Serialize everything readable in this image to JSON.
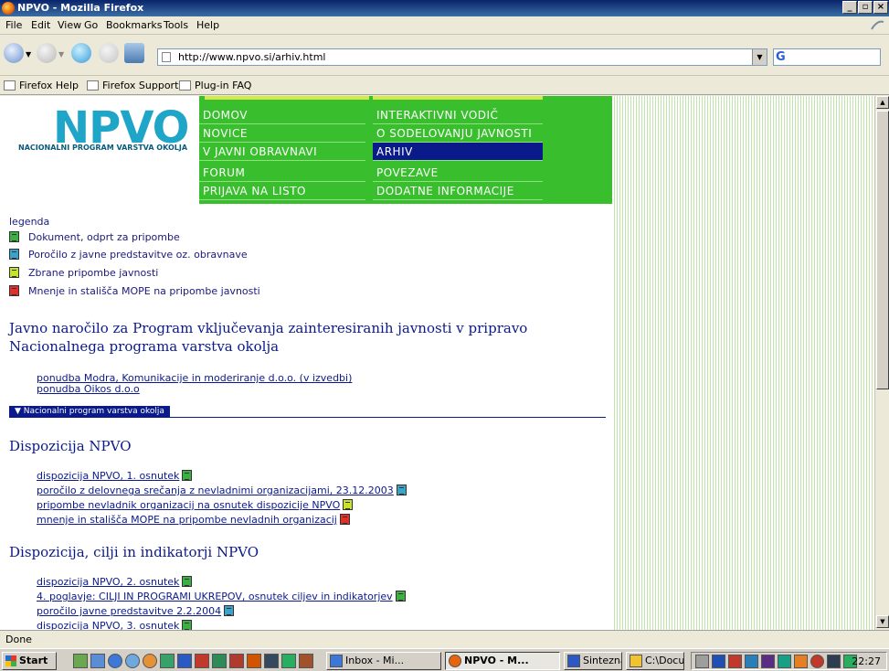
{
  "window": {
    "title": "NPVO - Mozilla Firefox",
    "controls": [
      "_",
      "▫",
      "×"
    ]
  },
  "menu": [
    "File",
    "Edit",
    "View",
    "Go",
    "Bookmarks",
    "Tools",
    "Help"
  ],
  "toolbar": {
    "url": "http://www.npvo.si/arhiv.html",
    "search_logo": "G"
  },
  "bookmarks": [
    "Firefox Help",
    "Firefox Support",
    "Plug-in FAQ"
  ],
  "site": {
    "logo": "NPVO",
    "logo_sub": "NACIONALNI PROGRAM VARSTVA OKOLJA",
    "nav_left": [
      "DOMOV",
      "NOVICE",
      "V JAVNI OBRAVNAVI",
      "FORUM",
      "PRIJAVA NA LISTO"
    ],
    "nav_right": [
      "INTERAKTIVNI VODIČ",
      "O SODELOVANJU JAVNOSTI",
      "ARHIV",
      "POVEZAVE",
      "DODATNE INFORMACIJE"
    ],
    "active_nav": "ARHIV",
    "legend_title": "legenda",
    "legend": [
      {
        "label": "Dokument, odprt za pripombe",
        "color": "#3cb043"
      },
      {
        "label": "Poročilo z javne predstavitve oz. obravnave",
        "color": "#3ba3c9"
      },
      {
        "label": "Zbrane pripombe javnosti",
        "color": "#c8e22a"
      },
      {
        "label": "Mnenje in stališča MOPE na pripombe javnosti",
        "color": "#e0302a"
      }
    ],
    "tender_title": "Javno naročilo za Program vključevanja zainteresiranih javnosti v pripravo Nacionalnega programa varstva okolja",
    "tender_links": [
      "ponudba Modra, Komunikacije in moderiranje d.o.o. (v izvedbi)",
      "ponudba Oikos d.o.o"
    ],
    "tab_label": "▼ Nacionalni program varstva okolja",
    "section1_title": "Dispozicija NPVO",
    "section1_links": [
      "dispozicija NPVO, 1. osnutek",
      "poročilo z delovnega srečanja z nevladnimi organizacijami, 23.12.2003",
      "pripombe nevladnik organizacij na osnutek dispozicije NPVO",
      "mnenje in stališča MOPE na pripombe nevladnih organizacij"
    ],
    "section2_title": "Dispozicija, cilji in indikatorji NPVO",
    "section2_links": [
      "dispozicija NPVO, 2. osnutek",
      "4. poglavje: CILJI IN PROGRAMI UKREPOV, osnutek ciljev in indikatorjev",
      "poročilo javne predstavitve 2.2.2004",
      "dispozicija NPVO, 3. osnutek"
    ]
  },
  "status": "Done",
  "taskbar": {
    "start": "Start",
    "tasks": [
      "Inbox - Mi...",
      "NPVO - M...",
      "Sintezna a...",
      "C:\\Docum..."
    ],
    "clock": "22:27"
  }
}
